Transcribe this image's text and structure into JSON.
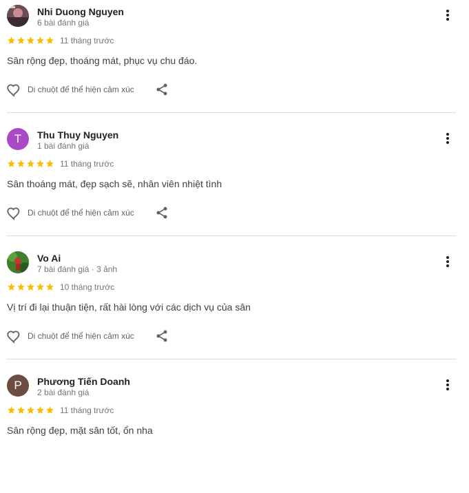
{
  "reviews": [
    {
      "name": "Nhi Duong Nguyen",
      "meta": "6 bài đánh giá",
      "rating": 5,
      "time": "11 tháng trước",
      "text": "Sân rộng đẹp, thoáng mát, phục vụ chu đáo.",
      "avatar_type": "photo",
      "avatar_color": "#7a5a63"
    },
    {
      "name": "Thu Thuy Nguyen",
      "meta": "1 bài đánh giá",
      "rating": 5,
      "time": "11 tháng trước",
      "text": "Sân thoáng mát, đẹp sạch sẽ, nhân viên nhiệt tình",
      "avatar_type": "initial",
      "avatar_letter": "T",
      "avatar_color": "#a94bc6"
    },
    {
      "name": "Vo Ai",
      "meta": "7 bài đánh giá · 3 ảnh",
      "rating": 5,
      "time": "10 tháng trước",
      "text": "Vị trí đi lại thuận tiện, rất hài lòng với các dịch vụ của sân",
      "avatar_type": "photo",
      "avatar_color": "#2f6b2a"
    },
    {
      "name": "Phương Tiến Doanh",
      "meta": "2 bài đánh giá",
      "rating": 5,
      "time": "11 tháng trước",
      "text": "Sân rộng đẹp, mặt sân tốt, ổn nha",
      "avatar_type": "initial",
      "avatar_letter": "P",
      "avatar_color": "#6d4c41"
    }
  ],
  "actions": {
    "like_label": "Di chuột để thể hiện cảm xúc"
  },
  "colors": {
    "star": "#fbbc04",
    "icon": "#5f6368",
    "divider": "#dadce0"
  },
  "icons": {
    "like": "heart-outline-icon",
    "share": "share-icon",
    "more": "more-vertical-icon",
    "star": "star-icon"
  }
}
